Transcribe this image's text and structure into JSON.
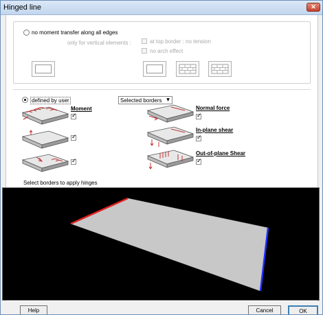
{
  "window": {
    "title": "Hinged line",
    "close_glyph": "✕"
  },
  "option_no_moment": {
    "label": "no moment transfer along all edges",
    "sublabel": "only for vertical elements :",
    "at_top_border": "at top border : no tension",
    "no_arch_effect": "no arch effect"
  },
  "option_user": {
    "label": "defined by user",
    "select_value": "Selected borders",
    "checks": {
      "moment": {
        "label": "Moment",
        "checked": true
      },
      "moment2": {
        "checked": true
      },
      "moment3": {
        "checked": true
      },
      "normal_force": {
        "label": "Normal force",
        "checked": true
      },
      "in_plane_shear": {
        "label": "In-plane shear",
        "checked": true
      },
      "out_of_plane_shear": {
        "label": "Out-of-plane Shear",
        "checked": true
      }
    }
  },
  "instruction": "Select borders to apply hinges",
  "buttons": {
    "help": "Help",
    "cancel": "Cancel",
    "ok": "OK"
  },
  "colors": {
    "viewport_bg": "#000000",
    "plate": "#c8c8c8",
    "edge_red": "#e02020",
    "edge_blue": "#2030ff"
  },
  "icons": [
    "plate-moment-icon",
    "plate-normal-force-icon",
    "plate-in-plane-shear-icon",
    "plate-out-of-plane-shear-icon",
    "wall-rect-icon",
    "brick-wall-icon"
  ]
}
